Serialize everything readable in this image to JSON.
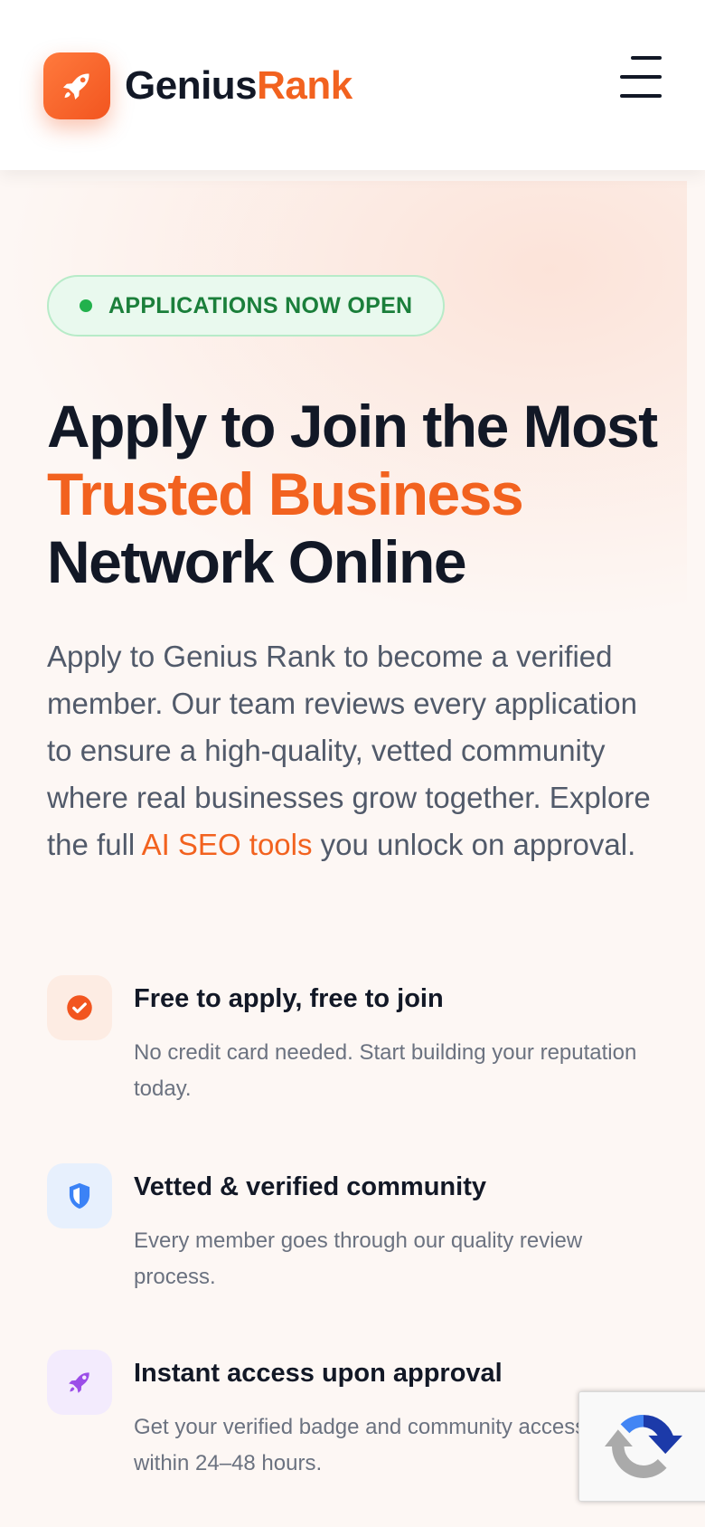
{
  "header": {
    "brand_name_part1": "Genius",
    "brand_name_part2": "Rank",
    "logo_icon": "rocket-icon",
    "menu_icon": "hamburger-menu-icon"
  },
  "hero": {
    "badge_text": "APPLICATIONS NOW OPEN",
    "headline_line1": "Apply to Join the Most",
    "headline_line2": "Trusted Business",
    "headline_line3": "Network Online",
    "intro_before_link": "Apply to Genius Rank to become a verified member. Our team reviews every application to ensure a high-quality, vetted community where real businesses grow together. Explore the full ",
    "intro_link": "AI SEO tools",
    "intro_after_link": " you unlock on approval."
  },
  "features": [
    {
      "icon": "check-circle-icon",
      "title": "Free to apply, free to join",
      "description": "No credit card needed. Start building your reputation today."
    },
    {
      "icon": "shield-icon",
      "title": "Vetted & verified community",
      "description": "Every member goes through our quality review process."
    },
    {
      "icon": "rocket-icon",
      "title": "Instant access upon approval",
      "description": "Get your verified badge and community access within 24–48 hours."
    }
  ],
  "colors": {
    "accent": "#f2621f",
    "text_dark": "#121826",
    "badge_green": "#1b7f3b",
    "shield_blue": "#3b82f6",
    "rocket_purple": "#9b4de8"
  },
  "recaptcha": {
    "icon": "recaptcha-icon"
  }
}
